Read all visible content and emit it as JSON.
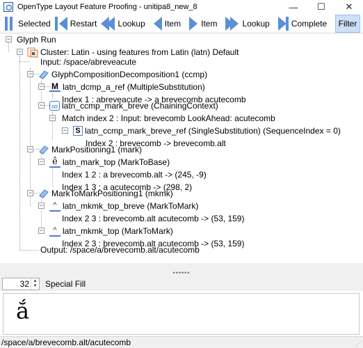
{
  "window": {
    "title": "OpenType Layout Feature Proofing - unitipa8_new_8",
    "minimize_glyph": "—",
    "maximize_glyph": "☐",
    "close_glyph": "✕"
  },
  "toolbar": {
    "selected_label": "Selected",
    "restart_label": "Restart",
    "lookup_prev_label": "Lookup",
    "item_prev_label": "Item",
    "item_next_label": "Item",
    "lookup_next_label": "Lookup",
    "complete_label": "Complete",
    "filter_label": "Filter"
  },
  "tree": {
    "root": "Glyph Run",
    "cluster": "Cluster: Latin - using features from Latin (latn) Default",
    "input": "Input: /space/abreveacute",
    "ccmp": "GlyphCompositionDecomposition1 (ccmp)",
    "dcmp": "latn_dcmp_a_ref (MultipleSubstitution)",
    "dcmp_index": "Index 1 : abreveacute -> a brevecomb acutecomb",
    "ccmp_mark": "latn_ccmp_mark_breve (ChainingContext)",
    "match": "Match index 2 : Input: brevecomb LookAhead: acutecomb",
    "ccmp_ref": "latn_ccmp_mark_breve_ref (SingleSubstitution) (SequenceIndex = 0)",
    "ccmp_ref_index": "Index 2 : brevecomb -> brevecomb.alt",
    "mark": "MarkPositioning1 (mark)",
    "mark_top": "latn_mark_top (MarkToBase)",
    "mark_index_1": "Index 1 2 : a brevecomb.alt -> (245, -9)",
    "mark_index_2": "Index 1 3 : a acutecomb -> (298, 2)",
    "mkmk": "MarkToMarkPositioning1 (mkmk)",
    "mkmk_breve": "latn_mkmk_top_breve (MarkToMark)",
    "mkmk_breve_index": "Index 2 3 : brevecomb.alt acutecomb -> (53, 159)",
    "mkmk_top": "latn_mkmk_top (MarkToMark)",
    "mkmk_top_index": "Index 2 3 : brevecomb.alt acutecomb -> (53, 159)",
    "output": "Output: /space/a/brevecomb.alt/acutecomb"
  },
  "splitter_handle": "••••••",
  "controls": {
    "font_size": "32",
    "fill_label": "Special Fill"
  },
  "preview": {
    "text": "ắ"
  },
  "status": {
    "text": "/space/a/brevecomb.alt/acutecomb"
  },
  "colors": {
    "accent": "#5b8fd6",
    "filter_active_bg": "#cde0f7",
    "feature_icon": "#4a7fc8",
    "cluster_icon": "#e07a2a"
  },
  "icons": {
    "dcmp": "M",
    "ccmp_mark": "∞",
    "ccmp_ref": "S",
    "mark_top": "ê",
    "mkmk": "^"
  }
}
